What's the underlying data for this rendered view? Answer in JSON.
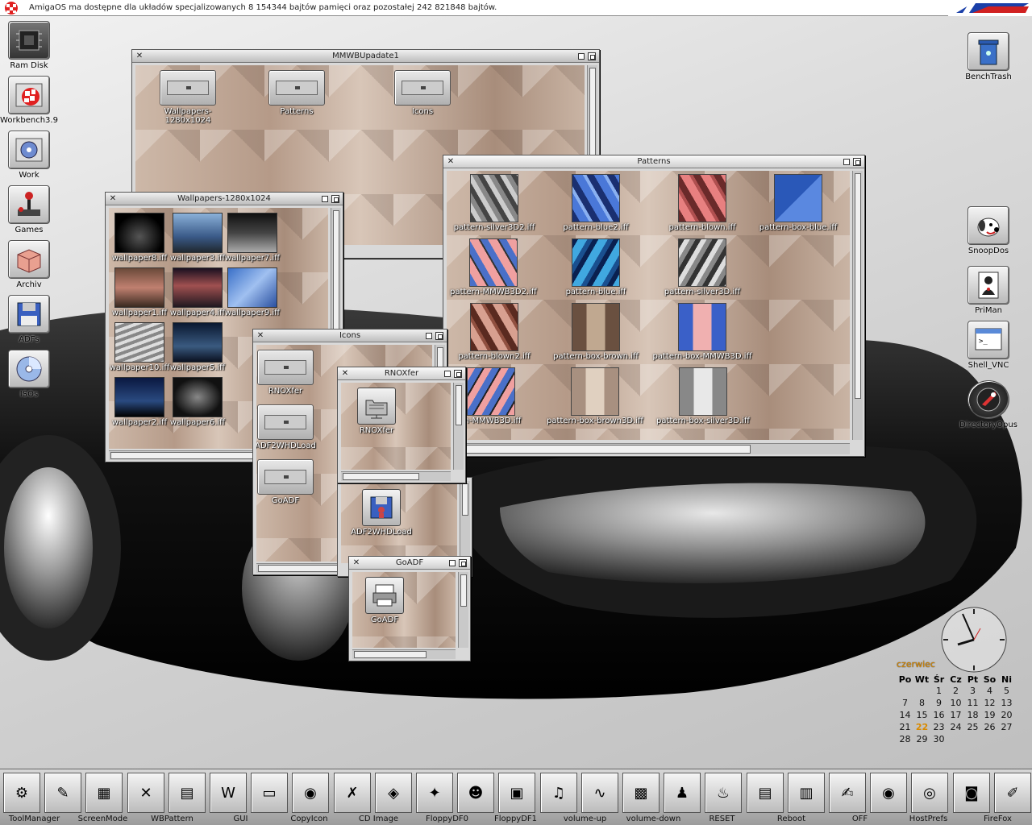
{
  "screen": {
    "title": "AmigaOS ma dostępne dla układów specjalizowanych 8 154344 bajtów pamięci oraz pozostałej 242 821848 bajtów."
  },
  "desktop_icons_left": [
    {
      "label": "Ram Disk"
    },
    {
      "label": "Workbench3.9"
    },
    {
      "label": "Work"
    },
    {
      "label": "Games"
    },
    {
      "label": "Archiv"
    },
    {
      "label": "ADFs"
    },
    {
      "label": "ISOs"
    }
  ],
  "desktop_icons_right": [
    {
      "label": "BenchTrash"
    },
    {
      "label": "SnoopDos"
    },
    {
      "label": "PriMan"
    },
    {
      "label": "Shell_VNC"
    },
    {
      "label": "DirectoryOpus"
    }
  ],
  "windows": {
    "mmwb": {
      "title": "MMWBUpadate1",
      "icons": [
        "Wallpapers-1280x1024",
        "Patterns",
        "Icons"
      ]
    },
    "patterns": {
      "title": "Patterns",
      "icons": [
        "pattern-silver3D2.iff",
        "pattern-blue2.iff",
        "pattern-blown.iff",
        "pattern-box-blue.iff",
        "pattern-MMWB3D2.iff",
        "pattern-blue.iff",
        "pattern-silver3D.iff",
        "pattern-blown2.iff",
        "pattern-box-brown.iff",
        "pattern-box-MMWB3D.iff",
        "rn-MMWB3D.iff",
        "pattern-box-brown3D.iff",
        "pattern-box-silver3D.iff"
      ]
    },
    "wallpapers": {
      "title": "Wallpapers-1280x1024",
      "icons": [
        "wallpaper8.iff",
        "wallpaper3.iff",
        "wallpaper7.iff",
        "wallpaper1.iff",
        "wallpaper4.iff",
        "wallpaper9.iff",
        "wallpaper10.iff",
        "wallpaper5.iff",
        "wallpaper2.iff",
        "wallpaper6.iff"
      ]
    },
    "icons": {
      "title": "Icons",
      "icons": [
        "RNOXfer",
        "ADF2WHDLoad",
        "GoADF"
      ]
    },
    "rnoxfer": {
      "title": "RNOXfer",
      "icons": [
        "RNOXfer"
      ]
    },
    "adf2whd": {
      "icons": [
        "ADF2WHDLoad"
      ]
    },
    "goadf": {
      "title": "GoADF",
      "icons": [
        "GoADF"
      ]
    }
  },
  "calendar": {
    "month": "czerwiec",
    "weekdays": [
      "Po",
      "Wt",
      "Śr",
      "Cz",
      "Pt",
      "So",
      "Ni"
    ],
    "weeks": [
      [
        "",
        "",
        "1",
        "2",
        "3",
        "4",
        "5"
      ],
      [
        "7",
        "8",
        "9",
        "10",
        "11",
        "12",
        "13"
      ],
      [
        "14",
        "15",
        "16",
        "17",
        "18",
        "19",
        "20"
      ],
      [
        "21",
        "22",
        "23",
        "24",
        "25",
        "26",
        "27"
      ],
      [
        "28",
        "29",
        "30",
        "",
        "",
        "",
        ""
      ]
    ],
    "today": "22"
  },
  "dock": {
    "labels": [
      "ToolManager",
      "ScreenMode",
      "WBPattern",
      "GUI",
      "CopyIcon",
      "CD Image",
      "FloppyDF0",
      "FloppyDF1",
      "volume-up",
      "volume-down",
      "RESET",
      "Reboot",
      "OFF",
      "HostPrefs",
      "FireFox"
    ],
    "icons": [
      "toolmanager-icon",
      "screenmode-icon",
      "wbpattern-icon",
      "gui-icon",
      "copyicon-icon",
      "pdf-icon",
      "browser-icon",
      "cdimage-icon",
      "art-effect-icon",
      "eagle-icon",
      "hippo-icon",
      "speaker-icon",
      "headphones-icon",
      "monitor-icon",
      "camera-icon",
      "joystick-icon",
      "flame-icon",
      "archive-icon",
      "notepad-icon",
      "writer-icon",
      "eye-icon",
      "eyes-icon",
      "photo-camera-icon",
      "paint-icon",
      "video-camera-icon"
    ]
  },
  "colors": {
    "calendar_accent": "#d98a00",
    "amiga_red": "#e02020"
  }
}
